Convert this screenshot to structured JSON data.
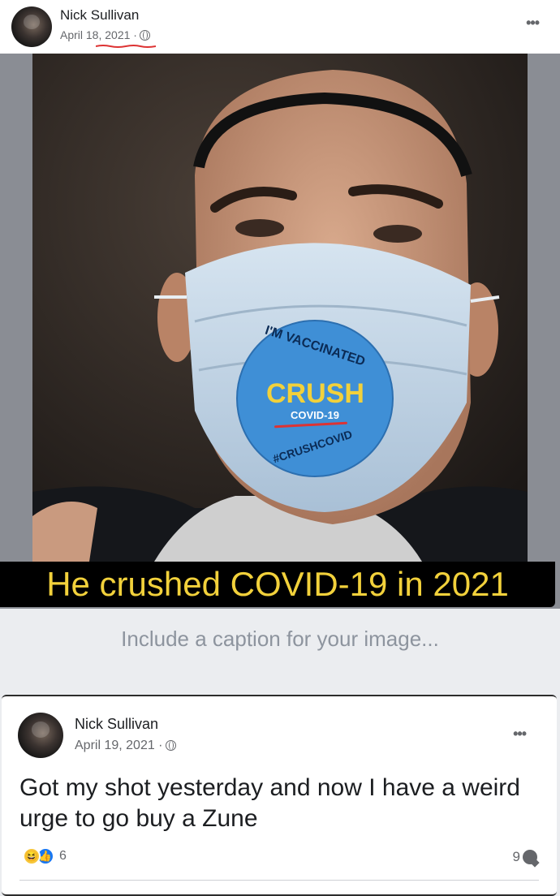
{
  "post1": {
    "author": "Nick Sullivan",
    "date": "April 18, 2021 ·",
    "privacy_icon": "globe-icon",
    "more_icon": "more-options-icon",
    "image_caption_overlay": "He crushed COVID-19 in 2021",
    "sticker": {
      "top_text": "I'M VACCINATED",
      "main_text": "CRUSH",
      "sub_text": "COVID-19",
      "bottom_text": "#CRUSHCOVID"
    }
  },
  "caption_prompt": "Include a caption for your image...",
  "post2": {
    "author": "Nick Sullivan",
    "date": "April 19, 2021 ·",
    "privacy_icon": "globe-icon",
    "more_icon": "more-options-icon",
    "text": "Got my shot yesterday and now I have a weird urge to go buy a Zune",
    "reaction_icons": [
      "haha-icon",
      "like-icon"
    ],
    "reaction_count": "6",
    "comment_count": "9"
  },
  "colors": {
    "caption_text": "#f2d13b",
    "caption_bg": "#000000",
    "sticker_blue": "#3f8fd6",
    "like_blue": "#1877f2"
  }
}
